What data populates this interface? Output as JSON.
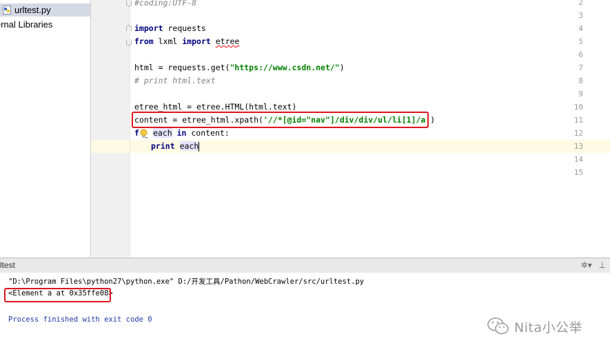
{
  "project": {
    "file_name": "urltest.py",
    "libraries_label": "ernal Libraries"
  },
  "editor": {
    "line_numbers": [
      "2",
      "3",
      "4",
      "5",
      "6",
      "7",
      "8",
      "9",
      "10",
      "11",
      "12",
      "13",
      "14",
      "15"
    ],
    "lines": {
      "l2": "#coding:UTF-8",
      "l4_kw": "import",
      "l4_rest": " requests",
      "l5_kw1": "from",
      "l5_mid": " lxml ",
      "l5_kw2": "import",
      "l5_sp": " ",
      "l5_mod": "etree",
      "l7_pre": "html = requests.get(",
      "l7_str": "\"https://www.csdn.net/\"",
      "l7_post": ")",
      "l8": "# print html.text",
      "l10": "etree_html = etree.HTML(html.text)",
      "l11_pre": "content = etree_html.xpath(",
      "l11_str": "'//*[@id=\"nav\"]/div/div/ul/li[1]/a'",
      "l11_post": ")",
      "l12_kw1": "f",
      "l12_var": "each",
      "l12_kw2": "in",
      "l12_rest": " content:",
      "l13_kw": "print",
      "l13_var": "each"
    }
  },
  "run": {
    "title": "rltest",
    "tools": [
      "gear-icon",
      "arrow-icon",
      "hide-icon"
    ],
    "tool_glyphs": [
      "✲▾",
      "⊥"
    ],
    "cmd": "\"D:\\Program Files\\python27\\python.exe\" D:/开发工具/Pathon/WebCrawler/src/urltest.py",
    "output": "<Element a at 0x35ffe08>",
    "exit": "Process finished with exit code 0"
  },
  "watermark": {
    "text": "Nita小公举"
  },
  "colors": {
    "keyword": "#000080",
    "string": "#008000",
    "comment": "#808080",
    "annotation": "#e0151b",
    "current_line": "#fffae3"
  }
}
